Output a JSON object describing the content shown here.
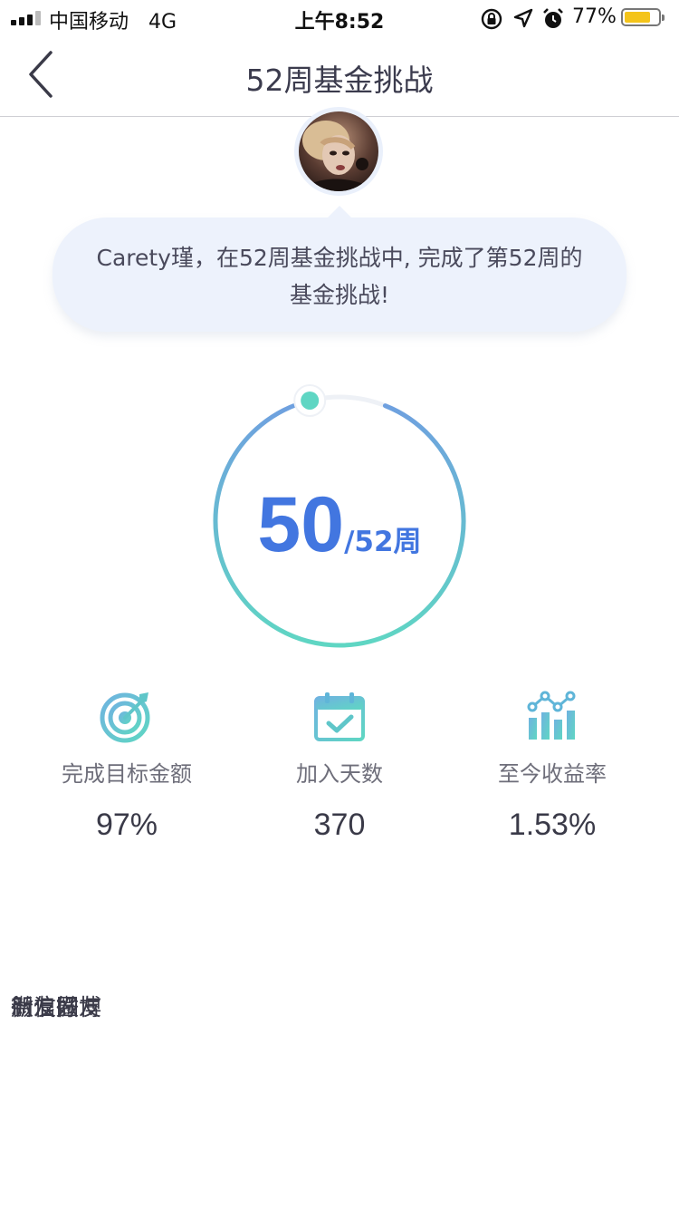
{
  "status_bar": {
    "carrier": "中国移动",
    "network": "4G",
    "time": "上午8:52",
    "battery_percent": "77%",
    "battery_level": 0.77,
    "icons": [
      "signal-icon",
      "orientation-lock-icon",
      "location-icon",
      "alarm-icon",
      "battery-icon"
    ]
  },
  "nav": {
    "title": "52周基金挑战",
    "back_icon": "chevron-left-icon"
  },
  "bubble": {
    "message": "Carety瑾，在52周基金挑战中, 完成了第52周的基金挑战!"
  },
  "progress": {
    "value": "50",
    "total": "/52周",
    "fraction": 0.9615,
    "ring_gradient": [
      "#6f9fe0",
      "#5fd6c3"
    ],
    "marker_color": "#5fd6c3"
  },
  "stats": [
    {
      "icon": "target-icon",
      "label": "完成目标金额",
      "value": "97%"
    },
    {
      "icon": "calendar-check-icon",
      "label": "加入天数",
      "value": "370"
    },
    {
      "icon": "bar-chart-icon",
      "label": "至今收益率",
      "value": "1.53%"
    }
  ],
  "share": {
    "labels": [
      "微信好友",
      "朋友圈",
      "新浪微博"
    ]
  },
  "colors": {
    "accent": "#4276e0",
    "teal": "#5fc6c9",
    "bubble_bg": "#edf2fc"
  }
}
